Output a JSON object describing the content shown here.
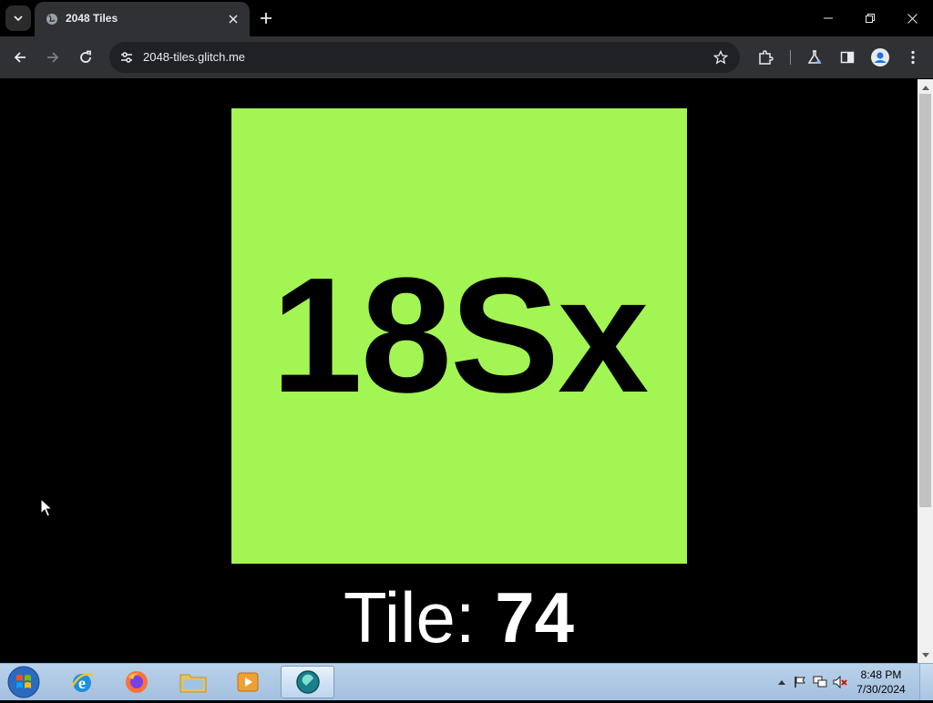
{
  "browser": {
    "tab_title": "2048 Tiles",
    "url": "2048-tiles.glitch.me"
  },
  "page": {
    "tile_label": "18Sx",
    "tile_color": "#a2f552",
    "caption_prefix": "Tile: ",
    "caption_number": "74",
    "background": "#000000"
  },
  "taskbar": {
    "time": "8:48 PM",
    "date": "7/30/2024",
    "apps": [
      "internet-explorer",
      "firefox",
      "file-explorer",
      "media-player",
      "active-browser"
    ]
  }
}
